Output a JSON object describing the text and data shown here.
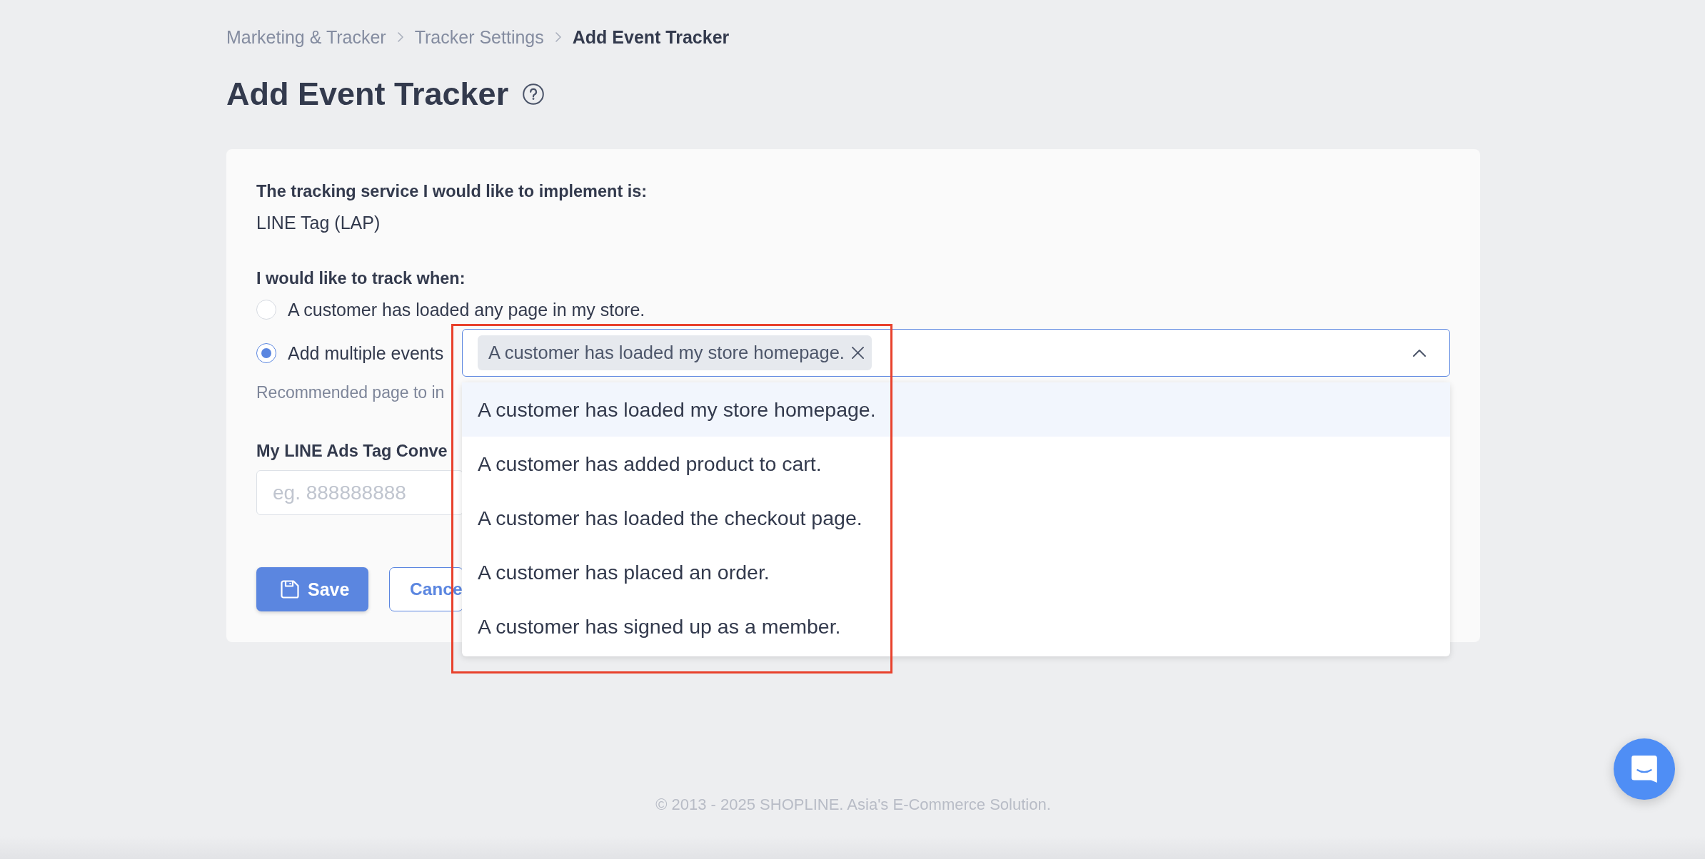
{
  "breadcrumb": {
    "items": [
      {
        "label": "Marketing & Tracker",
        "current": false
      },
      {
        "label": "Tracker Settings",
        "current": false
      },
      {
        "label": "Add Event Tracker",
        "current": true
      }
    ]
  },
  "page": {
    "title": "Add Event Tracker"
  },
  "form": {
    "service": {
      "label": "The tracking service I would like to implement is:",
      "value": "LINE Tag (LAP)"
    },
    "track_when": {
      "label": "I would like to track when:",
      "options": [
        {
          "label": "A customer has loaded any page in my store.",
          "selected": false,
          "kind": "plain"
        },
        {
          "label": "Add multiple events",
          "selected": true,
          "kind": "multiselect",
          "select": {
            "tags": [
              "A customer has loaded my store homepage."
            ],
            "expanded": true,
            "options": [
              {
                "label": "A customer has loaded my store homepage.",
                "selected": true
              },
              {
                "label": "A customer has added product to cart.",
                "selected": false
              },
              {
                "label": "A customer has loaded the checkout page.",
                "selected": false
              },
              {
                "label": "A customer has placed an order.",
                "selected": false
              },
              {
                "label": "A customer has signed up as a member.",
                "selected": false
              }
            ]
          }
        }
      ],
      "hint": "Recommended page to in"
    },
    "conversion_id": {
      "label": "My LINE Ads Tag Conve",
      "placeholder": "eg. 888888888"
    },
    "buttons": [
      {
        "label": "Save",
        "kind": "primary"
      },
      {
        "label": "Cance",
        "kind": "secondary"
      }
    ]
  },
  "footer": {
    "text": "© 2013 - 2025 SHOPLINE. Asia's E-Commerce Solution."
  }
}
